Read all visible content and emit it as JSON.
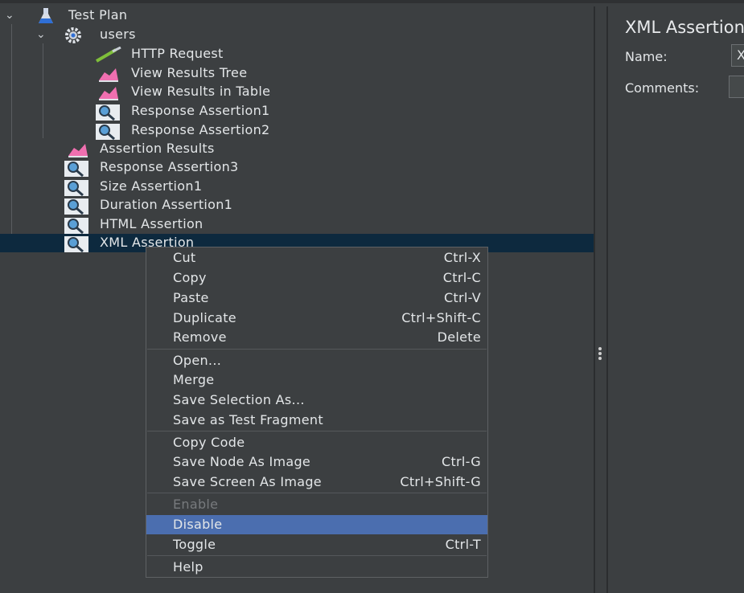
{
  "tree": {
    "root": "Test Plan",
    "thread_group": "users",
    "children": [
      "HTTP Request",
      "View Results Tree",
      "View Results in Table",
      "Response Assertion1",
      "Response Assertion2"
    ],
    "siblings": [
      "Assertion Results",
      "Response Assertion3",
      "Size Assertion1",
      "Duration Assertion1",
      "HTML Assertion",
      "XML Assertion"
    ]
  },
  "panel": {
    "title": "XML Assertion",
    "name_label": "Name:",
    "name_value": "X",
    "comments_label": "Comments:"
  },
  "context_menu": {
    "cut": {
      "label": "Cut",
      "shortcut": "Ctrl-X"
    },
    "copy": {
      "label": "Copy",
      "shortcut": "Ctrl-C"
    },
    "paste": {
      "label": "Paste",
      "shortcut": "Ctrl-V"
    },
    "duplicate": {
      "label": "Duplicate",
      "shortcut": "Ctrl+Shift-C"
    },
    "remove": {
      "label": "Remove",
      "shortcut": "Delete"
    },
    "open": {
      "label": "Open..."
    },
    "merge": {
      "label": "Merge"
    },
    "save_selection": {
      "label": "Save Selection As..."
    },
    "save_fragment": {
      "label": "Save as Test Fragment"
    },
    "copy_code": {
      "label": "Copy Code"
    },
    "save_node_image": {
      "label": "Save Node As Image",
      "shortcut": "Ctrl-G"
    },
    "save_screen_image": {
      "label": "Save Screen As Image",
      "shortcut": "Ctrl+Shift-G"
    },
    "enable": {
      "label": "Enable"
    },
    "disable": {
      "label": "Disable"
    },
    "toggle": {
      "label": "Toggle",
      "shortcut": "Ctrl-T"
    },
    "help": {
      "label": "Help"
    }
  },
  "colors": {
    "background": "#3c3f41",
    "selection": "#0d293e",
    "menu_highlight": "#4b6eaf",
    "text": "#e3e6e8",
    "disabled_text": "#777a7d"
  }
}
